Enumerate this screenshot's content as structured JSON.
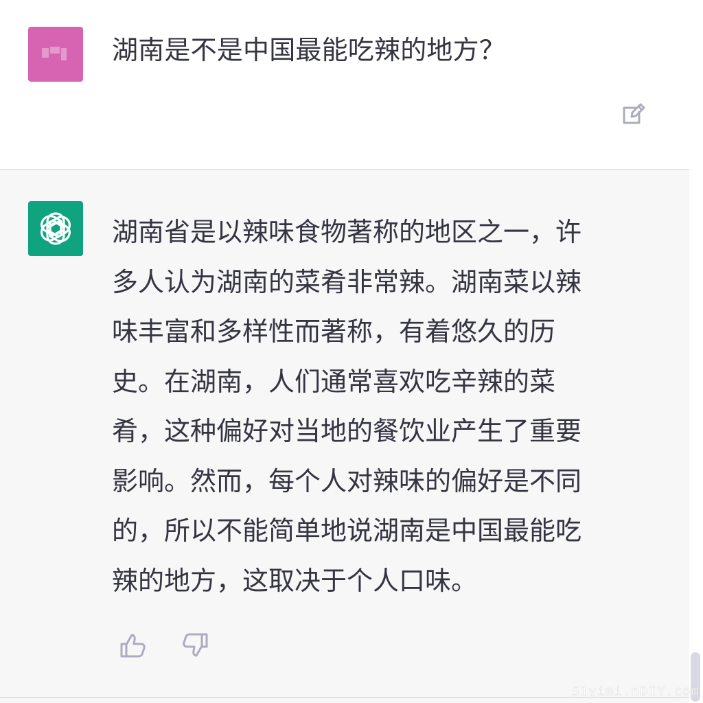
{
  "user": {
    "message": "湖南是不是中国最能吃辣的地方？",
    "edit_icon": "edit-icon"
  },
  "assistant": {
    "icon": "openai-logo-icon",
    "lines": [
      "湖南省是以辣味食物著称的地区之一，许",
      "多人认为湖南的菜肴非常辣。湖南菜以辣",
      "味丰富和多样性而著称，有着悠久的历",
      "史。在湖南，人们通常喜欢吃辛辣的菜",
      "肴，这种偏好对当地的餐饮业产生了重要",
      "影响。然而，每个人对辣味的偏好是不同",
      "的，所以不能简单地说湖南是中国最能吃",
      "辣的地方，这取决于个人口味。"
    ],
    "feedback": {
      "thumbs_up_icon": "thumbs-up-icon",
      "thumbs_down_icon": "thumbs-down-icon"
    }
  },
  "watermark": "51yimi.nDIY.com",
  "colors": {
    "user_avatar": "#d764b3",
    "assistant_avatar": "#10a37f",
    "assistant_background": "#f7f7f8",
    "text": "#343541",
    "icon": "#acacbe"
  }
}
